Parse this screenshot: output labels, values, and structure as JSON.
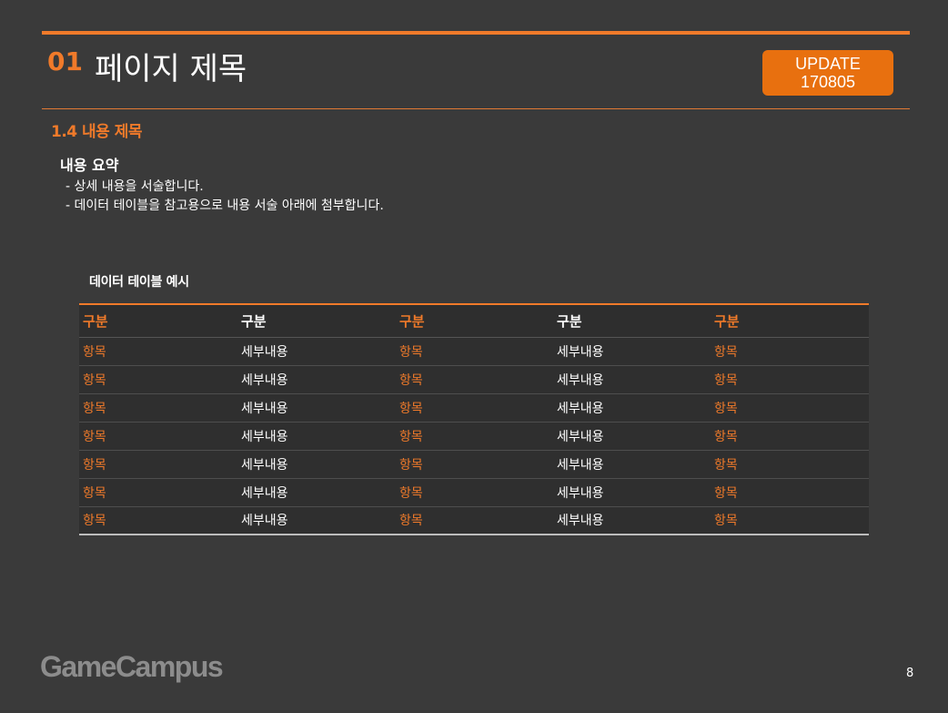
{
  "header": {
    "number": "01",
    "title": "페이지 제목",
    "update_label": "UPDATE",
    "update_date": "170805"
  },
  "section": {
    "title": "1.4 내용 제목"
  },
  "summary": {
    "heading": "내용 요약",
    "lines": [
      "- 상세 내용을 서술합니다.",
      "- 데이터 테이블을 참고용으로 내용 서술 아래에 첨부합니다."
    ]
  },
  "table": {
    "caption": "데이터 테이블 예시",
    "headers": [
      "구분",
      "구분",
      "구분",
      "구분",
      "구분"
    ],
    "rows": [
      [
        "항목",
        "세부내용",
        "항목",
        "세부내용",
        "항목"
      ],
      [
        "항목",
        "세부내용",
        "항목",
        "세부내용",
        "항목"
      ],
      [
        "항목",
        "세부내용",
        "항목",
        "세부내용",
        "항목"
      ],
      [
        "항목",
        "세부내용",
        "항목",
        "세부내용",
        "항목"
      ],
      [
        "항목",
        "세부내용",
        "항목",
        "세부내용",
        "항목"
      ],
      [
        "항목",
        "세부내용",
        "항목",
        "세부내용",
        "항목"
      ],
      [
        "항목",
        "세부내용",
        "항목",
        "세부내용",
        "항목"
      ]
    ]
  },
  "footer": {
    "logo": "GameCampus",
    "page_number": "8"
  },
  "colors": {
    "background": "#3a3a3a",
    "accent": "#f07a2a",
    "badge": "#e8700f"
  }
}
